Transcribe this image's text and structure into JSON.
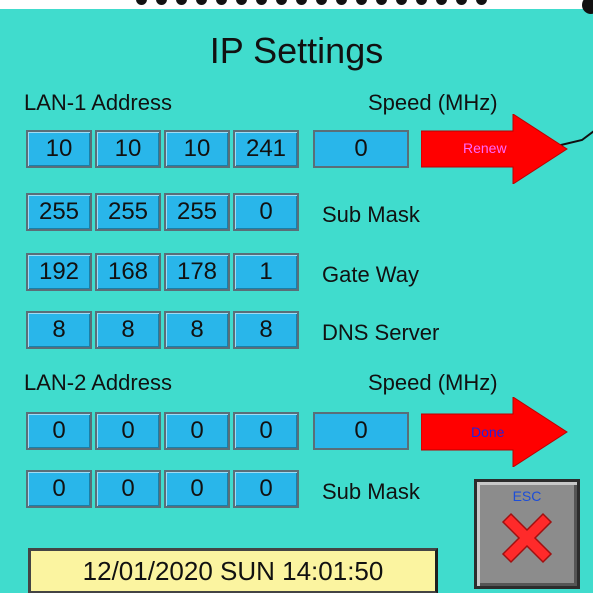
{
  "title": "IP Settings",
  "lan1": {
    "address_label": "LAN-1 Address",
    "speed_label": "Speed (MHz)",
    "ip": [
      "10",
      "10",
      "10",
      "241"
    ],
    "speed": "0",
    "action_label": "Renew",
    "subnet": [
      "255",
      "255",
      "255",
      "0"
    ],
    "subnet_label": "Sub Mask",
    "gateway": [
      "192",
      "168",
      "178",
      "1"
    ],
    "gateway_label": "Gate Way",
    "dns": [
      "8",
      "8",
      "8",
      "8"
    ],
    "dns_label": "DNS Server"
  },
  "lan2": {
    "address_label": "LAN-2 Address",
    "speed_label": "Speed (MHz)",
    "ip": [
      "0",
      "0",
      "0",
      "0"
    ],
    "speed": "0",
    "action_label": "Done",
    "subnet": [
      "0",
      "0",
      "0",
      "0"
    ],
    "subnet_label": "Sub Mask"
  },
  "esc_label": "ESC",
  "datetime": "12/01/2020 SUN 14:01:50",
  "colors": {
    "background": "#40dccd",
    "field": "#29b6ea",
    "arrow": "#ff0000",
    "renew_text": "#ff66ff",
    "done_text": "#2222dd",
    "esc_x": "#ff2a2a",
    "datetime_bg": "#fbf4a0"
  },
  "icons": {
    "renew": "arrow-right-icon",
    "done": "arrow-right-icon",
    "esc": "close-x-icon"
  }
}
